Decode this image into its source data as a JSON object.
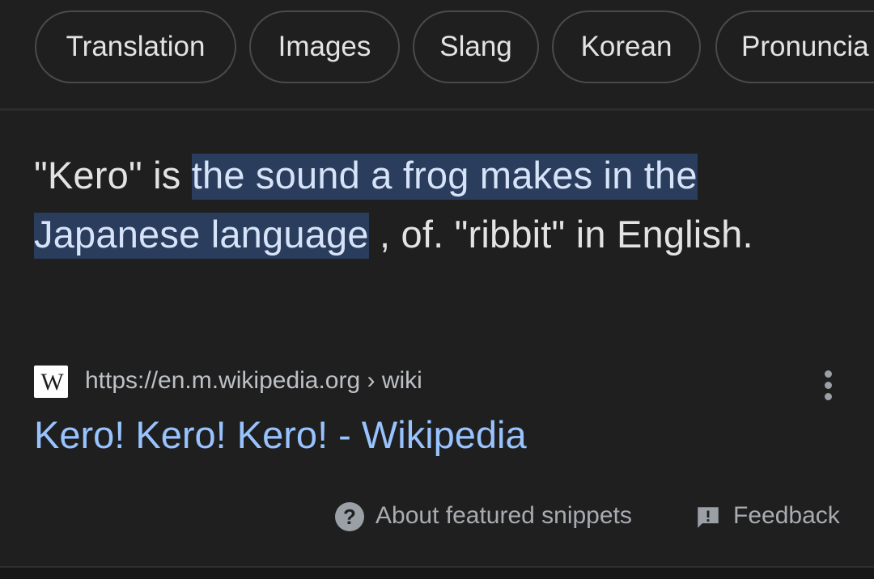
{
  "chips": [
    {
      "label": "Translation"
    },
    {
      "label": "Images"
    },
    {
      "label": "Slang"
    },
    {
      "label": "Korean"
    },
    {
      "label": "Pronuncia"
    }
  ],
  "snippet": {
    "prefix": "\"Kero\" is ",
    "highlight": "the sound a frog makes in the Japanese language",
    "suffix": " , of. \"ribbit\" in English.",
    "highlight_color": "#2a3d5c"
  },
  "source": {
    "favicon_text": "W",
    "favicon_icon": "wikipedia-w-icon",
    "url": "https://en.m.wikipedia.org",
    "breadcrumb": " › wiki",
    "more_icon": "more-vert-icon"
  },
  "result": {
    "title": "Kero! Kero! Kero! - Wikipedia",
    "link_color": "#99c3ff"
  },
  "footer": {
    "about_label": "About featured snippets",
    "about_icon": "help-circle-icon",
    "feedback_label": "Feedback",
    "feedback_icon": "feedback-icon"
  },
  "colors": {
    "background": "#1f1f1f",
    "text": "#e3e3e3",
    "muted": "#a8acb1"
  }
}
